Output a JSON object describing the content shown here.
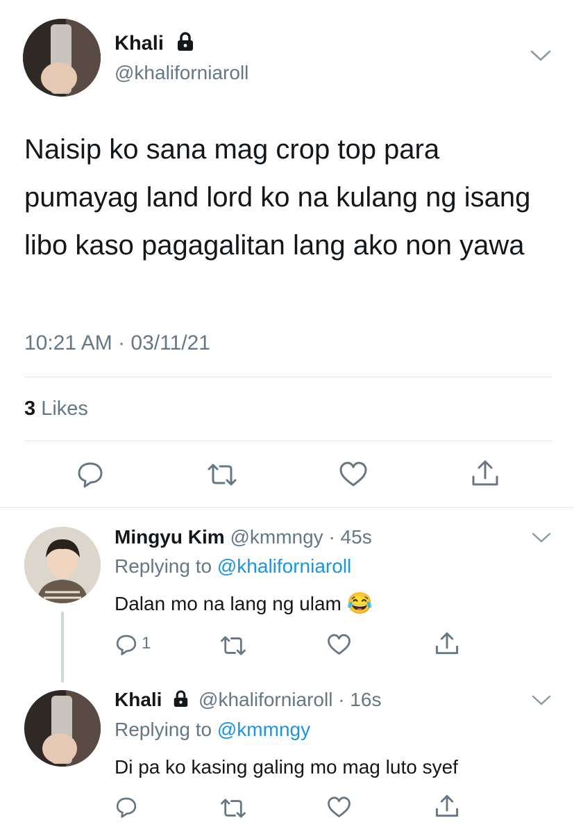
{
  "main_tweet": {
    "name": "Khali",
    "handle": "@khaliforniaroll",
    "text": "Naisip ko sana mag crop top para pumayag land lord ko na kulang ng isang libo kaso pagagalitan lang ako non yawa",
    "timestamp": "10:21 AM · 03/11/21",
    "likes_count": "3",
    "likes_label": "Likes"
  },
  "replies": [
    {
      "name": "Mingyu Kim",
      "handle": "@kmmngy",
      "time": "· 45s",
      "replying_label": "Replying to",
      "replying_to": "@khaliforniaroll",
      "text": "Dalan mo na lang ng ulam",
      "emoji": "😂",
      "reply_count": "1"
    },
    {
      "name": "Khali",
      "handle": "@khaliforniaroll",
      "time": "· 16s",
      "replying_label": "Replying to",
      "replying_to": "@kmmngy",
      "text": "Di pa ko kasing galing mo mag luto syef"
    }
  ],
  "colors": {
    "text": "#14171a",
    "secondary": "#657786",
    "link": "#1b95e0",
    "divider": "#e1e8ed"
  }
}
